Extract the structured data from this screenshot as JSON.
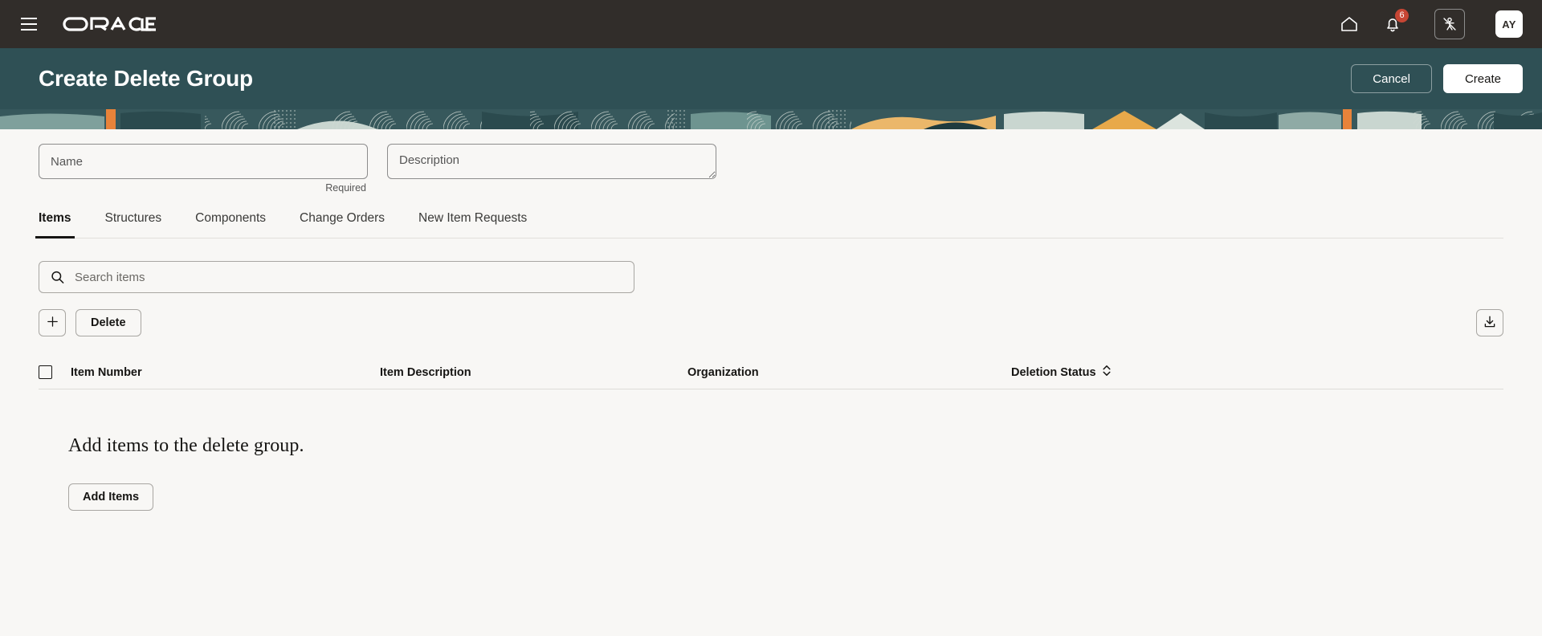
{
  "global_nav": {
    "menu_icon": "hamburger-menu-icon",
    "brand": "ORACLE",
    "home_icon": "home-icon",
    "notifications_icon": "bell-icon",
    "notifications_count": "6",
    "accessibility_icon": "person-crossed-out-icon",
    "avatar_initials": "AY"
  },
  "page_header": {
    "title": "Create Delete Group",
    "cancel_label": "Cancel",
    "create_label": "Create"
  },
  "form": {
    "name": {
      "value": "",
      "placeholder": "Name",
      "helper": "Required"
    },
    "description": {
      "value": "",
      "placeholder": "Description"
    }
  },
  "tabs": [
    {
      "label": "Items",
      "active": true
    },
    {
      "label": "Structures",
      "active": false
    },
    {
      "label": "Components",
      "active": false
    },
    {
      "label": "Change Orders",
      "active": false
    },
    {
      "label": "New Item Requests",
      "active": false
    }
  ],
  "search": {
    "value": "",
    "placeholder": "Search items",
    "icon": "search-icon"
  },
  "toolbar": {
    "add_icon": "plus-icon",
    "delete_label": "Delete",
    "export_icon": "download-icon"
  },
  "table": {
    "select_all_checkbox": "unchecked",
    "columns": [
      "Item Number",
      "Item Description",
      "Organization",
      "Deletion Status"
    ],
    "sort_icon": "sort-chevron-updown-icon",
    "rows": []
  },
  "empty_state": {
    "message": "Add items to the delete group.",
    "action_label": "Add Items"
  },
  "colors": {
    "nav_background": "#312D2A",
    "header_teal": "#2F5055",
    "page_background": "#F8F7F5",
    "badge_red": "#C74634",
    "text_primary": "#161513",
    "border": "#A8A6A2"
  }
}
